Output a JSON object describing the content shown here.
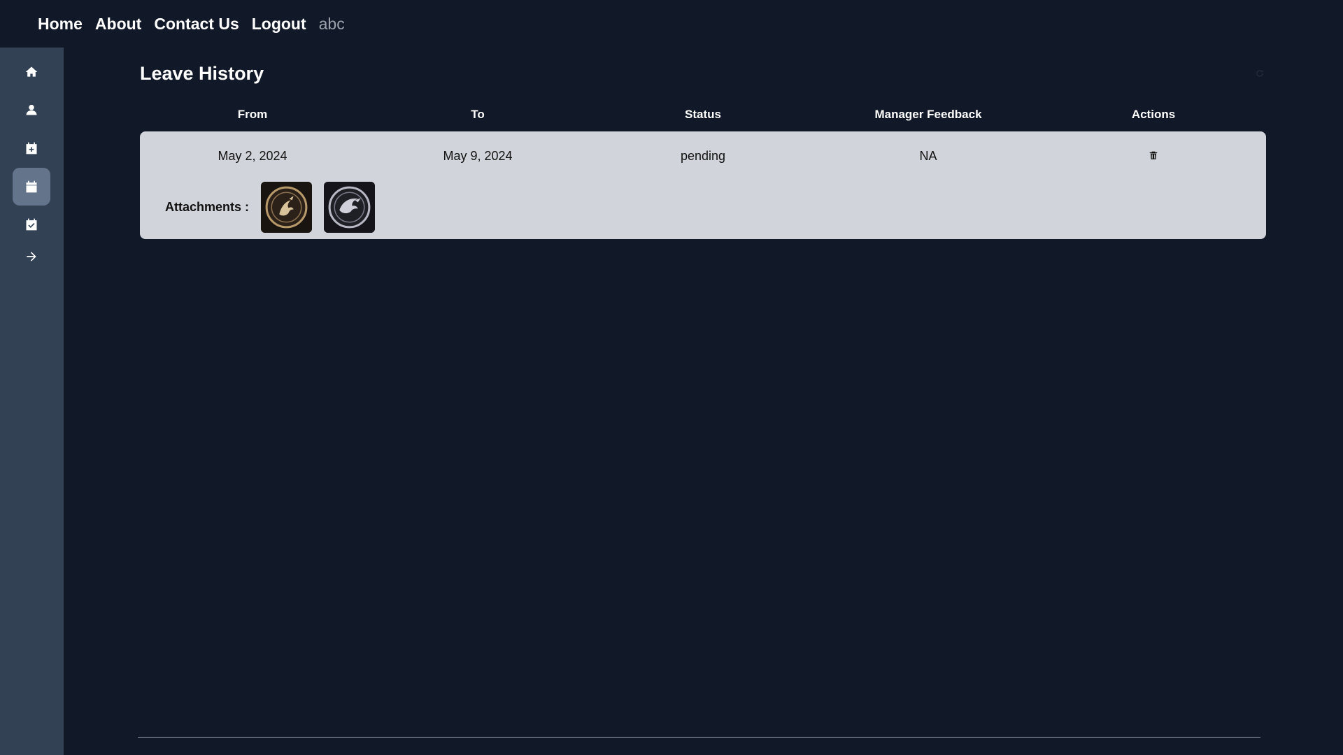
{
  "nav": {
    "home": "Home",
    "about": "About",
    "contact": "Contact Us",
    "logout": "Logout",
    "username": "abc"
  },
  "sidebar": {
    "items": [
      {
        "icon": "home-icon"
      },
      {
        "icon": "user-icon"
      },
      {
        "icon": "calendar-plus-icon"
      },
      {
        "icon": "calendar-icon",
        "active": true
      },
      {
        "icon": "calendar-check-icon"
      },
      {
        "icon": "arrow-right-icon"
      }
    ]
  },
  "page": {
    "title": "Leave History"
  },
  "table": {
    "headers": [
      "From",
      "To",
      "Status",
      "Manager Feedback",
      "Actions"
    ],
    "rows": [
      {
        "from": "May 2, 2024",
        "to": "May 9, 2024",
        "status": "pending",
        "feedback": "NA",
        "attachments_label": "Attachments :",
        "attachments": [
          "dragon-emblem-gold",
          "dragon-emblem-silver"
        ]
      }
    ]
  },
  "colors": {
    "background": "#111827",
    "sidebar": "#334155",
    "sidebar_active": "#64748b",
    "card": "#d1d5db",
    "muted_text": "#9ca3af"
  }
}
